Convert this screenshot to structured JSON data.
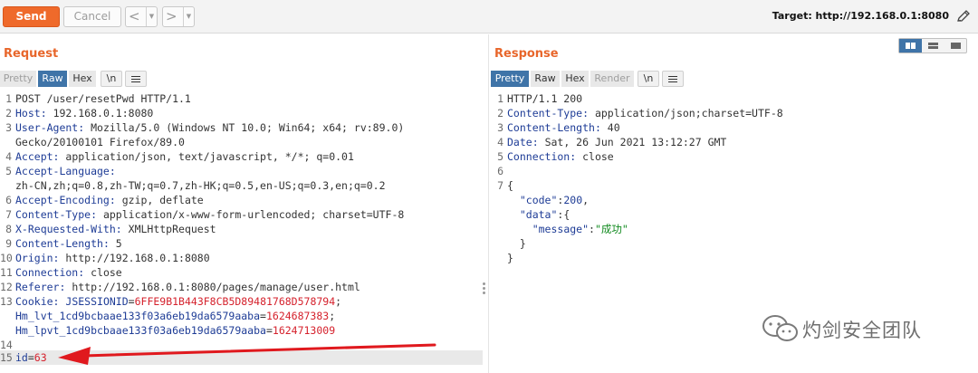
{
  "toolbar": {
    "send_label": "Send",
    "cancel_label": "Cancel",
    "back_glyph": "<",
    "forward_glyph": ">",
    "dropdown_glyph": "▼",
    "target_label": "Target: http://192.168.0.1:8080",
    "edit_icon": "pencil-icon"
  },
  "request": {
    "title": "Request",
    "tabs": [
      "Pretty",
      "Raw",
      "Hex",
      "\\n"
    ],
    "selected_tab": "Raw",
    "lines": [
      {
        "num": "1",
        "key": "",
        "value": "POST /user/resetPwd HTTP/1.1"
      },
      {
        "num": "2",
        "key": "Host",
        "value": " 192.168.0.1:8080"
      },
      {
        "num": "3",
        "key": "User-Agent",
        "value": " Mozilla/5.0 (Windows NT 10.0; Win64; x64; rv:89.0)"
      },
      {
        "num": "",
        "key": "",
        "value": "Gecko/20100101 Firefox/89.0"
      },
      {
        "num": "4",
        "key": "Accept",
        "value": " application/json, text/javascript, */*; q=0.01"
      },
      {
        "num": "5",
        "key": "Accept-Language",
        "value": ""
      },
      {
        "num": "",
        "key": "",
        "value": "zh-CN,zh;q=0.8,zh-TW;q=0.7,zh-HK;q=0.5,en-US;q=0.3,en;q=0.2"
      },
      {
        "num": "6",
        "key": "Accept-Encoding",
        "value": " gzip, deflate"
      },
      {
        "num": "7",
        "key": "Content-Type",
        "value": " application/x-www-form-urlencoded; charset=UTF-8"
      },
      {
        "num": "8",
        "key": "X-Requested-With",
        "value": " XMLHttpRequest"
      },
      {
        "num": "9",
        "key": "Content-Length",
        "value": " 5"
      },
      {
        "num": "10",
        "key": "Origin",
        "value": " http://192.168.0.1:8080"
      },
      {
        "num": "11",
        "key": "Connection",
        "value": " close"
      },
      {
        "num": "12",
        "key": "Referer",
        "value": " http://192.168.0.1:8080/pages/manage/user.html"
      }
    ],
    "cookie": {
      "num": "13",
      "key": "Cookie",
      "items": [
        {
          "name": "JSESSIONID",
          "value": "6FFE9B1B443F8CB5D89481768D578794",
          "sep": ";"
        },
        {
          "name": "Hm_lvt_1cd9bcbaae133f03a6eb19da6579aaba",
          "value": "1624687383",
          "sep": ";"
        },
        {
          "name": "Hm_lpvt_1cd9bcbaae133f03a6eb19da6579aaba",
          "value": "1624713009",
          "sep": ""
        }
      ]
    },
    "blank_num": "14",
    "body": {
      "num": "15",
      "name": "id",
      "value": "63"
    }
  },
  "response": {
    "title": "Response",
    "tabs": [
      "Pretty",
      "Raw",
      "Hex",
      "Render",
      "\\n"
    ],
    "selected_tab": "Pretty",
    "lines": [
      {
        "num": "1",
        "key": "",
        "value": "HTTP/1.1 200"
      },
      {
        "num": "2",
        "key": "Content-Type",
        "value": " application/json;charset=UTF-8"
      },
      {
        "num": "3",
        "key": "Content-Length",
        "value": " 40"
      },
      {
        "num": "4",
        "key": "Date",
        "value": " Sat, 26 Jun 2021 13:12:27 GMT"
      },
      {
        "num": "5",
        "key": "Connection",
        "value": " close"
      },
      {
        "num": "6",
        "key": "",
        "value": ""
      }
    ],
    "json_num": "7",
    "json": {
      "open": "{",
      "code_key": "\"code\"",
      "code_value": "200",
      "data_key": "\"data\"",
      "data_open": "{",
      "message_key": "\"message\"",
      "message_value": "\"成功\"",
      "data_close": "}",
      "close": "}"
    }
  },
  "watermark": {
    "text": "灼剑安全团队",
    "icon": "wechat-icon"
  },
  "colors": {
    "accent": "#e8662b",
    "send": "#ef6a2b",
    "selected_tab": "#3f74a8",
    "arrow": "#e0191e"
  }
}
